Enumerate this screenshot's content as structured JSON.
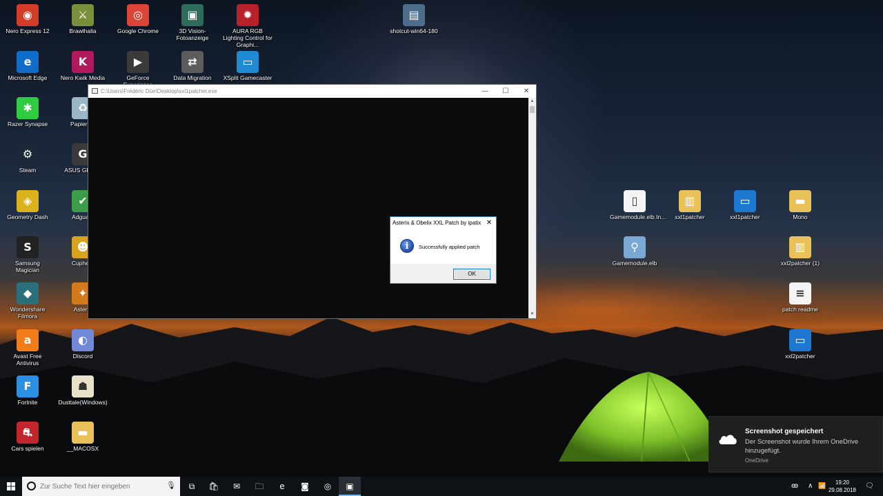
{
  "desktop": {
    "icons": [
      {
        "label": "Nero Express 12",
        "icon": "nero-express-icon",
        "color": "#d43c2a",
        "glyph": "◉"
      },
      {
        "label": "Brawlhalla",
        "icon": "brawlhalla-icon",
        "color": "#7a8f3a",
        "glyph": "⚔"
      },
      {
        "label": "Google Chrome",
        "icon": "chrome-icon",
        "color": "#db4437",
        "glyph": "◎"
      },
      {
        "label": "3D Vision-Fotoanzeige",
        "icon": "3d-vision-icon",
        "color": "#2d6b5b",
        "glyph": "▣"
      },
      {
        "label": "AURA RGB Lighting Control for Graphi...",
        "icon": "aura-rgb-icon",
        "color": "#b8212a",
        "glyph": "✹"
      },
      {
        "label": "Microsoft Edge",
        "icon": "edge-icon",
        "color": "#0f6cc9",
        "glyph": "e"
      },
      {
        "label": "Nero Kwik Media",
        "icon": "nero-kwik-icon",
        "color": "#b01a5a",
        "glyph": "K"
      },
      {
        "label": "GeForce Experience",
        "icon": "geforce-icon",
        "color": "#3a3a3a",
        "glyph": "▶"
      },
      {
        "label": "Data Migration",
        "icon": "data-migration-icon",
        "color": "#5c5c5c",
        "glyph": "⇄"
      },
      {
        "label": "XSplit Gamecaster",
        "icon": "xsplit-icon",
        "color": "#1f8ad1",
        "glyph": "▭"
      },
      {
        "label": "Razer Synapse",
        "icon": "razer-icon",
        "color": "#2ecc40",
        "glyph": "✱"
      },
      {
        "label": "Papierk...",
        "icon": "recycle-bin-icon",
        "color": "#9ab6c8",
        "glyph": "♻"
      },
      {
        "label": "Steam",
        "icon": "steam-icon",
        "color": "#1b2838",
        "glyph": "⚙"
      },
      {
        "label": "ASUS GPU ...",
        "icon": "asus-gpu-icon",
        "color": "#3a3a3a",
        "glyph": "G"
      },
      {
        "label": "Geometry Dash",
        "icon": "geometry-dash-icon",
        "color": "#d9b21c",
        "glyph": "◈"
      },
      {
        "label": "Adgua...",
        "icon": "adguard-icon",
        "color": "#3c9c4a",
        "glyph": "✔"
      },
      {
        "label": "Samsung Magician",
        "icon": "samsung-magician-icon",
        "color": "#222222",
        "glyph": "S"
      },
      {
        "label": "Cuphe...",
        "icon": "cuphead-icon",
        "color": "#d8a21f",
        "glyph": "☻"
      },
      {
        "label": "Wondershare Filmora",
        "icon": "filmora-icon",
        "color": "#2a6f79",
        "glyph": "◆"
      },
      {
        "label": "Aster...",
        "icon": "asterix-icon",
        "color": "#d37a1c",
        "glyph": "✦"
      },
      {
        "label": "Avast Free Antivirus",
        "icon": "avast-icon",
        "color": "#f07d1a",
        "glyph": "a"
      },
      {
        "label": "Discord",
        "icon": "discord-icon",
        "color": "#7289da",
        "glyph": "◐"
      },
      {
        "label": "Fortnite",
        "icon": "fortnite-icon",
        "color": "#2b8fe3",
        "glyph": "F"
      },
      {
        "label": "Dusttale(Windows)",
        "icon": "dusttale-icon",
        "color": "#e8e2c8",
        "glyph": "☗"
      },
      {
        "label": "Cars spielen",
        "icon": "cars-icon",
        "color": "#c0262c",
        "glyph": "⛐"
      },
      {
        "label": "__MACOSX",
        "icon": "folder-icon",
        "color": "#e8c15a",
        "glyph": "▬"
      },
      {
        "label": "shotcut-win64-180",
        "icon": "shotcut-icon",
        "color": "#4e6e8e",
        "glyph": "▤"
      },
      {
        "label": "Gamemodule.elb.In...",
        "icon": "file-icon",
        "color": "#f4f4f4",
        "glyph": "▯"
      },
      {
        "label": "xxl1patcher",
        "icon": "zip-folder-icon",
        "color": "#e8c15a",
        "glyph": "▥"
      },
      {
        "label": "xxl1patcher",
        "icon": "exe-icon",
        "color": "#1e78d2",
        "glyph": "▭"
      },
      {
        "label": "Mono",
        "icon": "folder-icon",
        "color": "#e8c15a",
        "glyph": "▬"
      },
      {
        "label": "Gamemodule.elb",
        "icon": "magnifier-file-icon",
        "color": "#7aa7d4",
        "glyph": "⚲"
      },
      {
        "label": "xxl2patcher (1)",
        "icon": "zip-folder-icon",
        "color": "#e8c15a",
        "glyph": "▥"
      },
      {
        "label": "patch readme",
        "icon": "text-file-icon",
        "color": "#f4f4f4",
        "glyph": "≡"
      },
      {
        "label": "xxl2patcher",
        "icon": "exe-icon",
        "color": "#1e78d2",
        "glyph": "▭"
      }
    ]
  },
  "console_window": {
    "title": "C:\\Users\\Frédéric Düe\\Desktop\\xxl1patcher.exe",
    "minimize": "—",
    "maximize": "☐",
    "close": "✕"
  },
  "message_box": {
    "title": "Asterix & Obelix XXL Patch by ipatix",
    "close": "✕",
    "icon_glyph": "i",
    "message": "Successfully applied patch",
    "ok_label": "OK"
  },
  "toast": {
    "title": "Screenshot gespeichert",
    "body": "Der Screenshot wurde Ihrem OneDrive hinzugefügt.",
    "source": "OneDrive"
  },
  "taskbar": {
    "search_placeholder": "Zur Suche Text hier eingeben",
    "time": "19:20",
    "date": "29.08.2018",
    "apps": [
      {
        "name": "task-view",
        "glyph": "⧉"
      },
      {
        "name": "store",
        "glyph": "🛍"
      },
      {
        "name": "mail",
        "glyph": "✉"
      },
      {
        "name": "file-explorer",
        "glyph": "🗀"
      },
      {
        "name": "edge",
        "glyph": "e"
      },
      {
        "name": "app-red",
        "glyph": "◙"
      },
      {
        "name": "chrome",
        "glyph": "◎"
      },
      {
        "name": "console",
        "glyph": "▣"
      }
    ],
    "tray": {
      "people": "ꙭ",
      "chevron": "∧",
      "network": "📶",
      "volume": "🔈",
      "notification": "🗨"
    }
  }
}
